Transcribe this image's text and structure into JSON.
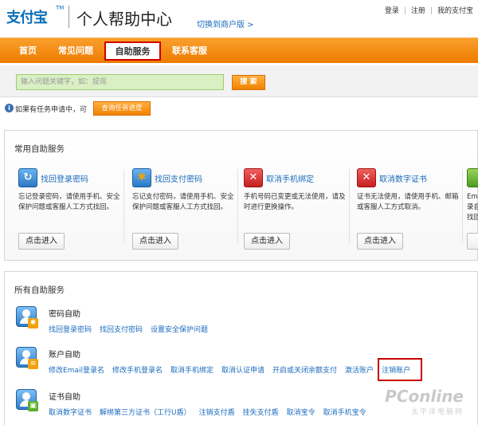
{
  "header": {
    "logo_text": "支付宝",
    "logo_tm": "TM",
    "title": "个人帮助中心",
    "merchant_link": "切换到商户版 >",
    "top_links": [
      "登录",
      "注册",
      "我的支付宝"
    ]
  },
  "nav": {
    "items": [
      "首页",
      "常见问题",
      "自助服务",
      "联系客服"
    ],
    "active": "自助服务"
  },
  "search": {
    "placeholder": "输入问题关键字，如：提现",
    "button": "搜 索"
  },
  "task": {
    "text": "如果有任务申请中，可",
    "button": "查询任务进度"
  },
  "common": {
    "title": "常用自助服务",
    "services": [
      {
        "name": "找回登录密码",
        "desc": "忘记登录密码，请使用手机、安全保护问题或客服人工方式找回。",
        "button": "点击进入",
        "icon": "lock-refresh-icon",
        "color": "#2c78c4"
      },
      {
        "name": "找回支付密码",
        "desc": "忘记支付密码，请使用手机、安全保护问题或客服人工方式找回。",
        "button": "点击进入",
        "icon": "key-refresh-icon",
        "color": "#2c78c4"
      },
      {
        "name": "取消手机绑定",
        "desc": "手机号码已变更或无法使用，请及时进行更换操作。",
        "button": "点击进入",
        "icon": "phone-cancel-icon",
        "color": "#c51f1f"
      },
      {
        "name": "取消数字证书",
        "desc": "证书无法使用，请使用手机、邮箱或客服人工方式取消。",
        "button": "点击进入",
        "icon": "certificate-cancel-icon",
        "color": "#c51f1f"
      },
      {
        "name": "",
        "desc": "Ema 录自 找回",
        "button": "",
        "icon": "email-icon",
        "color": "#4e9a1f"
      }
    ]
  },
  "all": {
    "title": "所有自助服务",
    "categories": [
      {
        "title": "密码自助",
        "links": [
          "找回登录密码",
          "找回支付密码",
          "设置安全保护问题"
        ],
        "icon": "password-icon"
      },
      {
        "title": "账户自助",
        "links": [
          "修改Email登录名",
          "修改手机登录名",
          "取消手机绑定",
          "取消认证申请",
          "开启或关闭余额支付",
          "激活账户",
          "注销账户"
        ],
        "icon": "account-icon",
        "highlighted": "注销账户"
      },
      {
        "title": "证书自助",
        "links": [
          "取消数字证书",
          "解绑第三方证书（工行U盾）",
          "注销支付盾",
          "挂失支付盾",
          "取消宝令",
          "取消手机宝令"
        ],
        "icon": "certificate-icon"
      }
    ]
  },
  "watermark": {
    "brand": "PConline",
    "sub": "太平洋电脑网"
  }
}
